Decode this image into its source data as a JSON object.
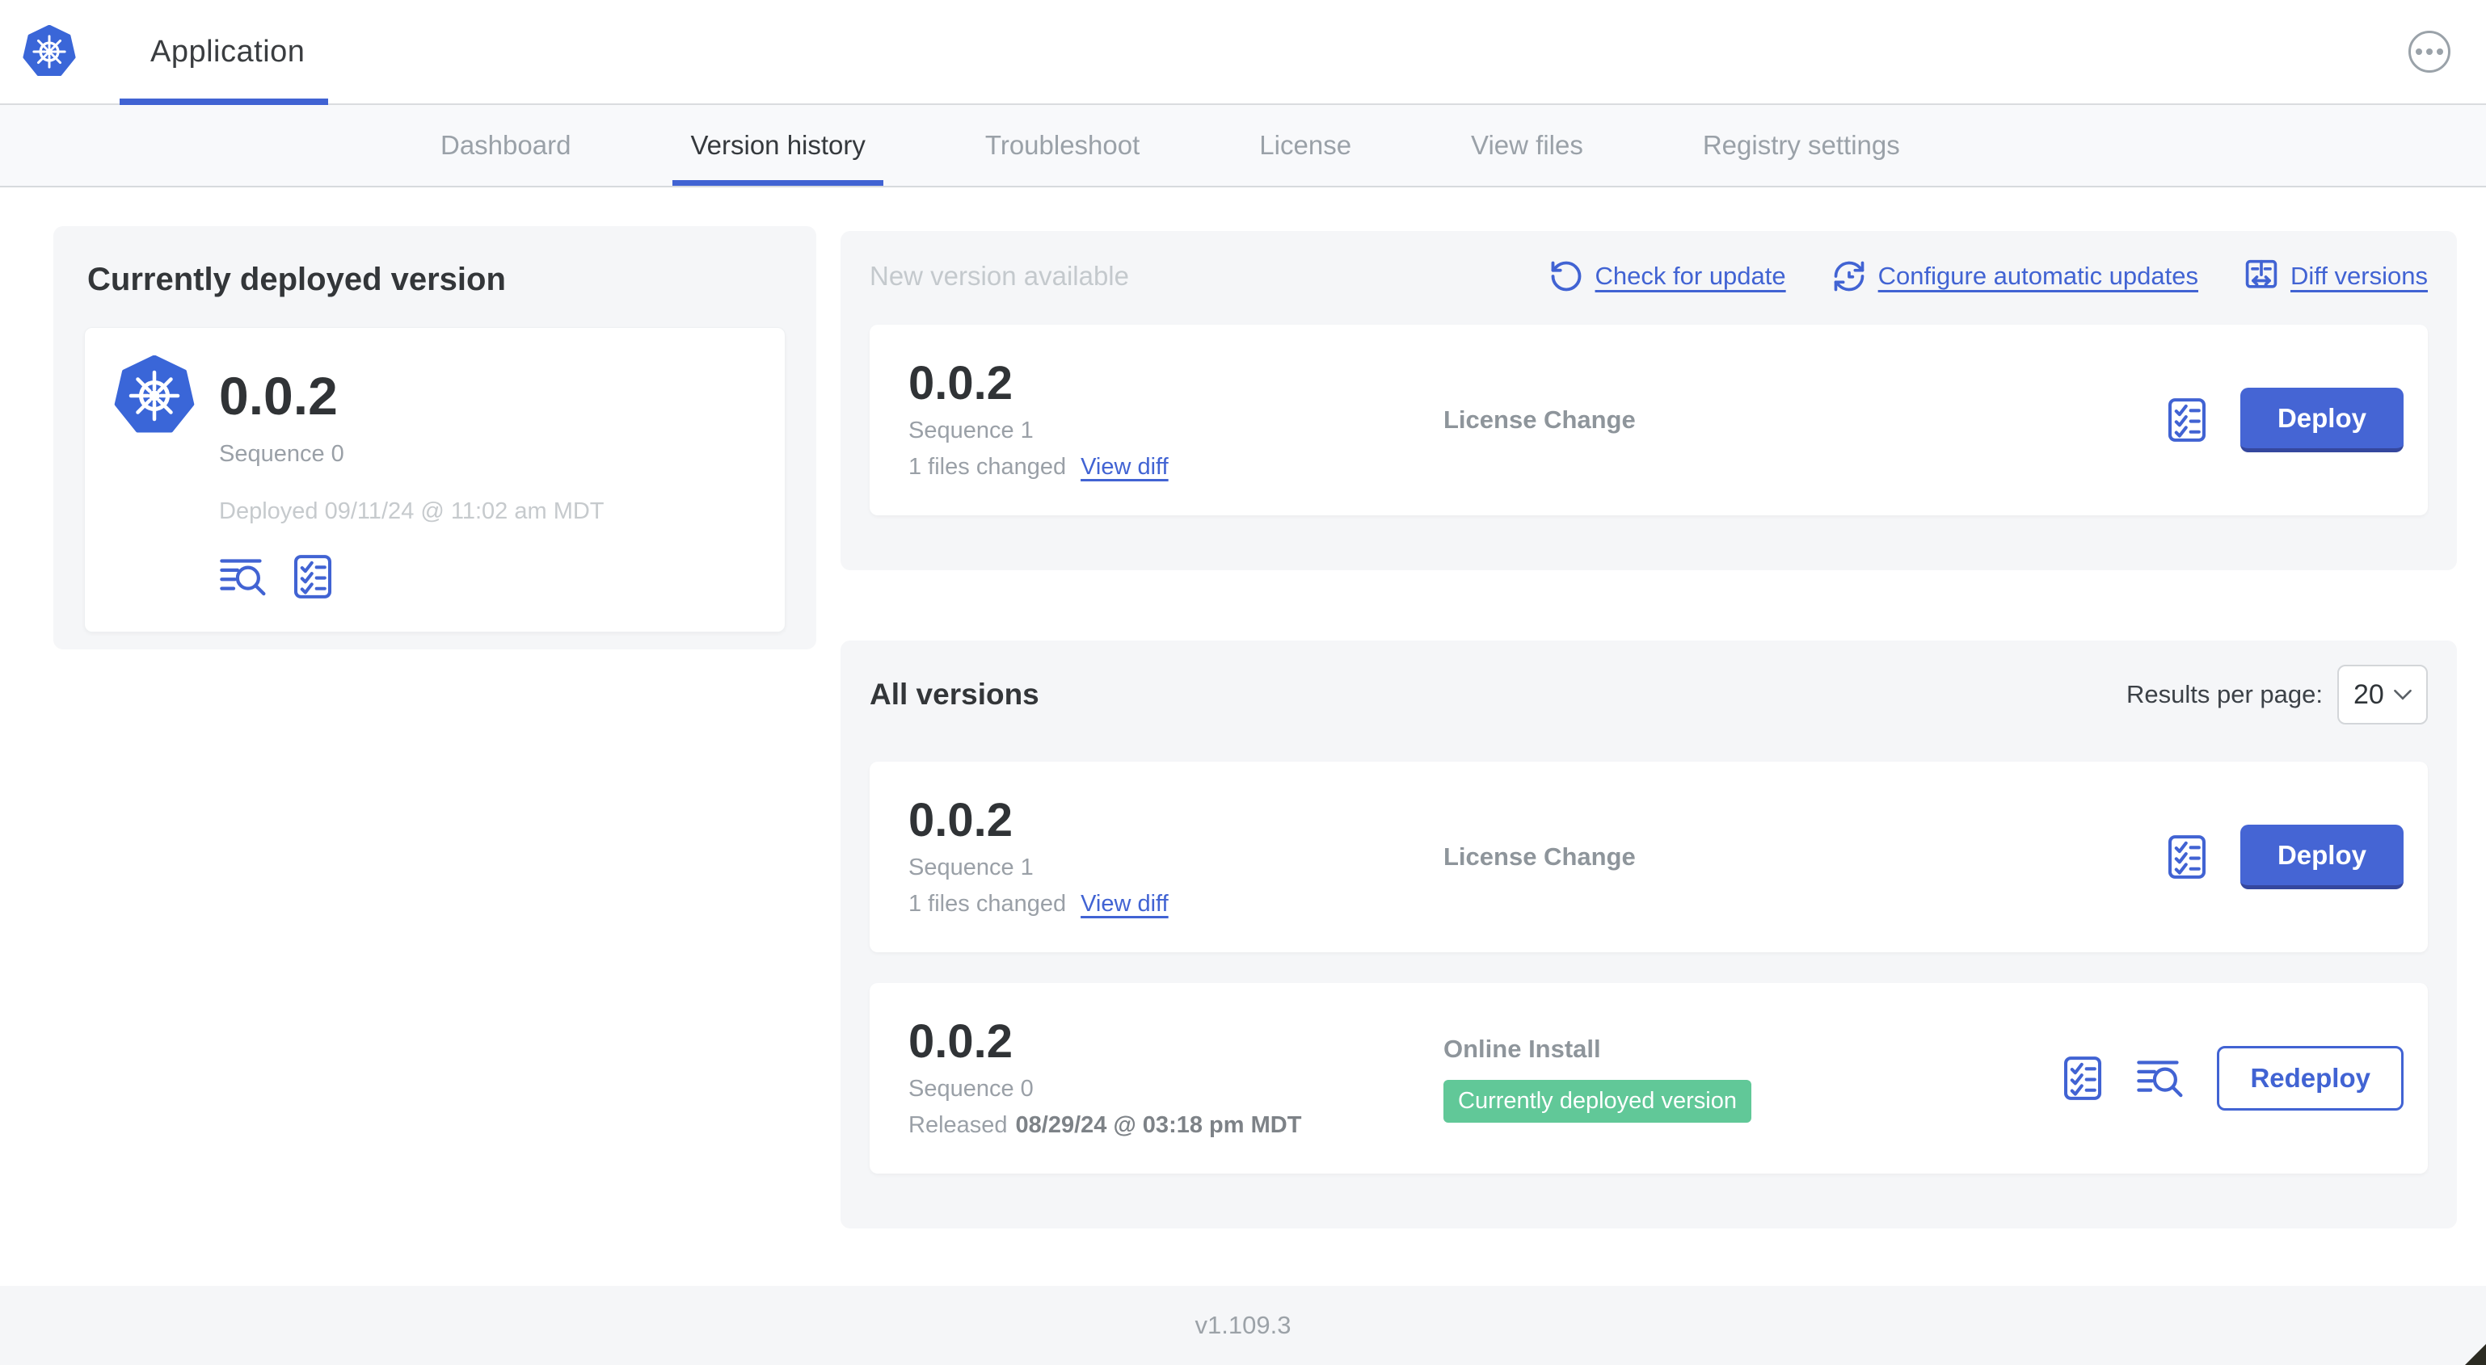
{
  "header": {
    "app_title": "Application",
    "menu_icon": "ellipsis-icon"
  },
  "tabs": [
    {
      "label": "Dashboard"
    },
    {
      "label": "Version history"
    },
    {
      "label": "Troubleshoot"
    },
    {
      "label": "License"
    },
    {
      "label": "View files"
    },
    {
      "label": "Registry settings"
    }
  ],
  "active_tab": "Version history",
  "deployed_card": {
    "title": "Currently deployed version",
    "version": "0.0.2",
    "sequence": "Sequence 0",
    "deployed_at": "Deployed 09/11/24 @ 11:02 am MDT",
    "icons": [
      "logs-icon",
      "checklist-icon"
    ]
  },
  "new_version": {
    "title": "New version available",
    "actions": [
      {
        "label": "Check for update",
        "icon": "refresh-icon"
      },
      {
        "label": "Configure automatic updates",
        "icon": "clock-sync-icon"
      },
      {
        "label": "Diff versions",
        "icon": "diff-icon"
      }
    ],
    "row": {
      "version": "0.0.2",
      "sequence": "Sequence 1",
      "files_changed": "1 files changed",
      "view_diff_label": "View diff",
      "source": "License Change",
      "deploy_label": "Deploy"
    }
  },
  "all_versions": {
    "title": "All versions",
    "results_per_page_label": "Results per page:",
    "results_per_page_value": "20",
    "rows": [
      {
        "version": "0.0.2",
        "sequence": "Sequence 1",
        "files_changed": "1 files changed",
        "view_diff_label": "View diff",
        "source": "License Change",
        "action_label": "Deploy",
        "icons": [
          "checklist-icon"
        ]
      },
      {
        "version": "0.0.2",
        "sequence": "Sequence 0",
        "released_prefix": "Released",
        "released_date": "08/29/24 @ 03:18 pm MDT",
        "source": "Online Install",
        "badge": "Currently deployed version",
        "action_label": "Redeploy",
        "icons": [
          "checklist-icon",
          "logs-icon"
        ]
      }
    ]
  },
  "footer": {
    "app_version": "v1.109.3"
  },
  "colors": {
    "accent_blue": "#4163d3",
    "button_blue": "#4565d4",
    "badge_green": "#61c898",
    "section_bg": "#f5f6f8",
    "kubernetes_blue": "#3a66d8"
  }
}
